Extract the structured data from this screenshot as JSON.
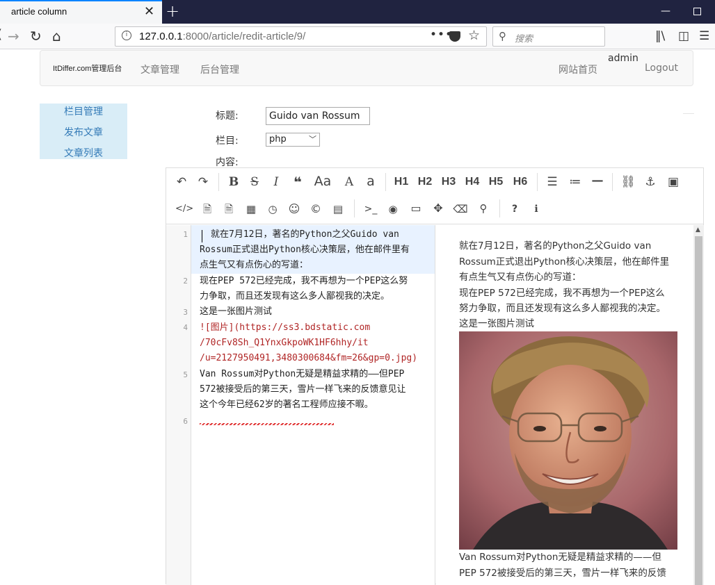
{
  "browser": {
    "tab_title": "article column",
    "url_host": "127.0.0.1",
    "url_path": ":8000/article/redit-article/9/",
    "search_placeholder": "搜索"
  },
  "header": {
    "brand": "ItDiffer.com管理后台",
    "nav": [
      "文章管理",
      "后台管理"
    ],
    "site_home": "网站首页",
    "user": "admin",
    "logout": "Logout"
  },
  "sidebar": {
    "items": [
      {
        "label": "栏目管理"
      },
      {
        "label": "发布文章"
      },
      {
        "label": "文章列表"
      }
    ]
  },
  "form": {
    "title_label": "标题:",
    "title_value": "Guido van Rossum",
    "column_label": "栏目:",
    "column_value": "php",
    "content_label": "内容:"
  },
  "toolbar": {
    "headings": [
      "H1",
      "H2",
      "H3",
      "H4",
      "H5",
      "H6"
    ]
  },
  "editor": {
    "line_numbers": [
      "1",
      "2",
      "3",
      "4",
      "5",
      "6"
    ],
    "code_lines": [
      "就在7月12日，著名的Python之父Guido van",
      "Rossum正式退出Python核心决策层，他在邮件里有",
      "点生气又有点伤心的写道：",
      "现在PEP 572已经完成，我不再想为一个PEP这么努",
      "力争取，而且还发现有这么多人鄙视我的决定。",
      "这是一张图片测试",
      "![图片](https://ss3.bdstatic.com",
      "/70cFv8Sh_Q1YnxGkpoWK1HF6hhy/it",
      "/u=2127950491,3480300684&fm=26&gp=0.jpg)",
      "Van Rossum对Python无疑是精益求精的——但PEP",
      "572被接受后的第三天，雪片一样飞来的反馈意见让",
      "这个今年已经62岁的著名工程师应接不暇。"
    ]
  },
  "preview": {
    "lines": [
      "就在7月12日，著名的Python之父Guido van",
      "Rossum正式退出Python核心决策层，他在邮件里",
      "有点生气又有点伤心的写道：",
      "现在PEP 572已经完成，我不再想为一个PEP这么",
      "努力争取，而且还发现有这么多人鄙视我的决定。",
      "这是一张图片测试",
      "Van Rossum对Python无疑是精益求精的——但",
      "PEP 572被接受后的第三天，雪片一样飞来的反馈"
    ]
  }
}
